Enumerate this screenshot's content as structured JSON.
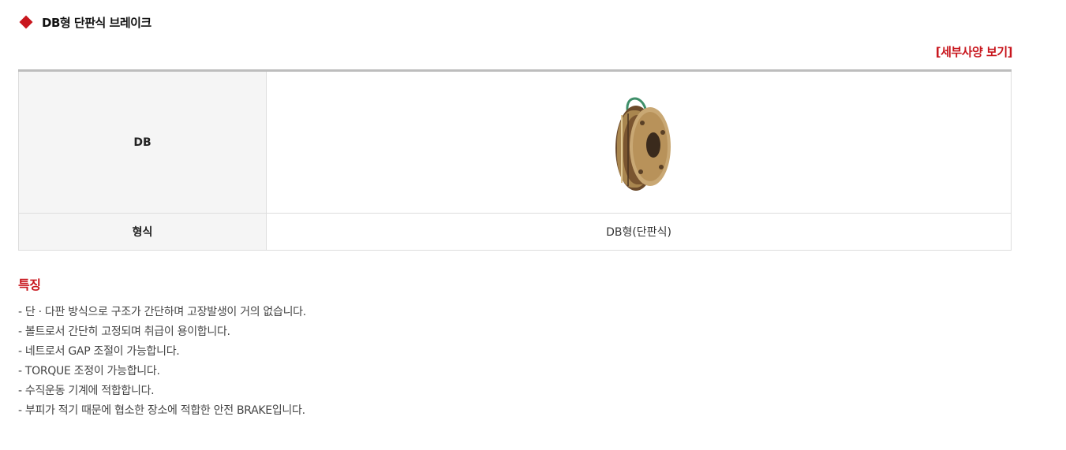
{
  "header": {
    "title": "DB형 단판식 브레이크"
  },
  "spec_link": "[세부사양 보기]",
  "table": {
    "model_label": "DB",
    "type_label": "형식",
    "type_value": "DB형(단판식)"
  },
  "features": {
    "title": "특징",
    "items": [
      "- 단 · 다판 방식으로 구조가 간단하며 고장발생이 거의 없습니다.",
      "- 볼트로서 간단히 고정되며 취급이 용이합니다.",
      "- 네트로서 GAP 조절이 가능합니다.",
      "- TORQUE 조정이 가능합니다.",
      "- 수직운동 기계에 적합합니다.",
      "- 부피가 적기 때문에 협소한 장소에 적합한 안전 BRAKE입니다."
    ]
  },
  "colors": {
    "accent": "#c8161d",
    "table_head_bg": "#f5f5f5",
    "border": "#dddddd"
  },
  "icons": {
    "title_marker": "red-diamond-icon"
  }
}
